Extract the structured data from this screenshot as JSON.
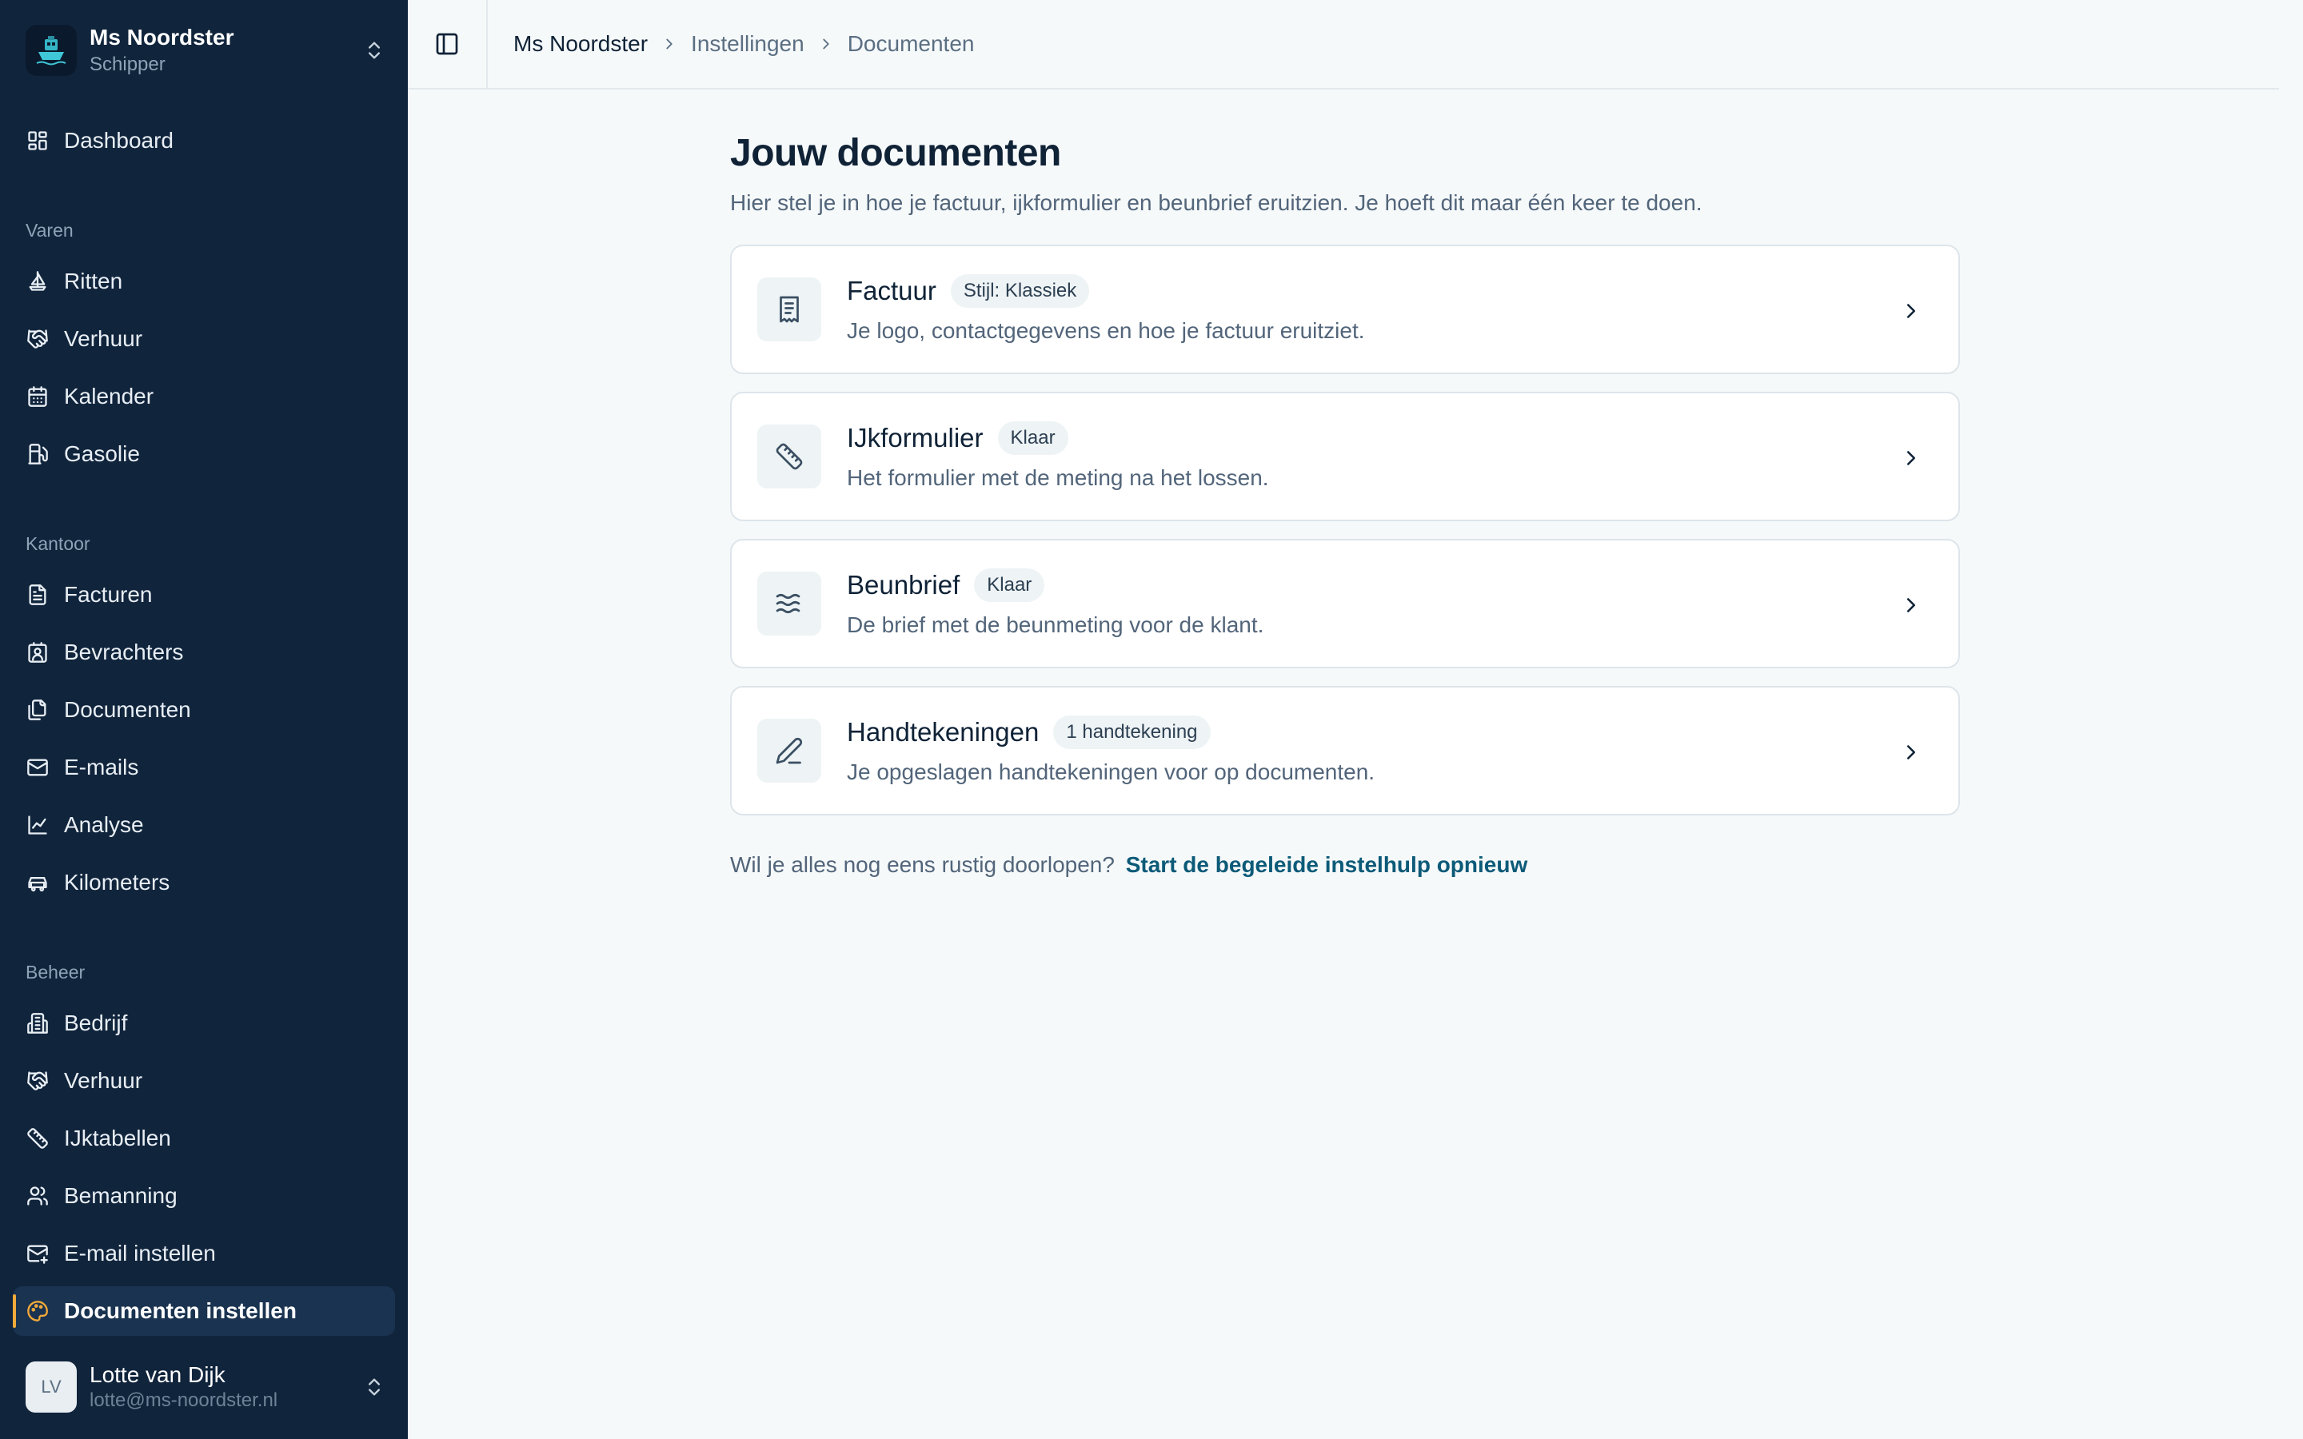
{
  "sidebar": {
    "org": {
      "name": "Ms Noordster",
      "role": "Schipper",
      "logo_icon": "ship-logo-icon"
    },
    "dashboard": {
      "label": "Dashboard",
      "icon": "dashboard-icon"
    },
    "groups": [
      {
        "label": "Varen",
        "items": [
          {
            "label": "Ritten",
            "icon": "sailboat-icon"
          },
          {
            "label": "Verhuur",
            "icon": "handshake-icon"
          },
          {
            "label": "Kalender",
            "icon": "calendar-icon"
          },
          {
            "label": "Gasolie",
            "icon": "fuel-icon"
          }
        ]
      },
      {
        "label": "Kantoor",
        "items": [
          {
            "label": "Facturen",
            "icon": "file-text-icon"
          },
          {
            "label": "Bevrachters",
            "icon": "contact-icon"
          },
          {
            "label": "Documenten",
            "icon": "files-icon"
          },
          {
            "label": "E-mails",
            "icon": "mail-icon"
          },
          {
            "label": "Analyse",
            "icon": "chart-line-icon"
          },
          {
            "label": "Kilometers",
            "icon": "car-icon"
          }
        ]
      },
      {
        "label": "Beheer",
        "items": [
          {
            "label": "Bedrijf",
            "icon": "building-icon"
          },
          {
            "label": "Verhuur",
            "icon": "handshake-icon"
          },
          {
            "label": "IJktabellen",
            "icon": "ruler-icon"
          },
          {
            "label": "Bemanning",
            "icon": "users-icon"
          },
          {
            "label": "E-mail instellen",
            "icon": "mail-settings-icon"
          },
          {
            "label": "Documenten instellen",
            "icon": "palette-icon",
            "active": true
          }
        ]
      }
    ],
    "user": {
      "initials": "LV",
      "name": "Lotte van Dijk",
      "email": "lotte@ms-noordster.nl"
    }
  },
  "topbar": {
    "breadcrumb": [
      "Ms Noordster",
      "Instellingen",
      "Documenten"
    ]
  },
  "main": {
    "title": "Jouw documenten",
    "subtitle": "Hier stel je in hoe je factuur, ijkformulier en beunbrief eruitzien. Je hoeft dit maar één keer te doen.",
    "cards": [
      {
        "title": "Factuur",
        "badge": "Stijl: Klassiek",
        "description": "Je logo, contactgegevens en hoe je factuur eruitziet.",
        "icon": "receipt-icon"
      },
      {
        "title": "IJkformulier",
        "badge": "Klaar",
        "description": "Het formulier met de meting na het lossen.",
        "icon": "ruler-icon"
      },
      {
        "title": "Beunbrief",
        "badge": "Klaar",
        "description": "De brief met de beunmeting voor de klant.",
        "icon": "waves-icon"
      },
      {
        "title": "Handtekeningen",
        "badge": "1 handtekening",
        "description": "Je opgeslagen handtekeningen voor op documenten.",
        "icon": "pen-icon"
      }
    ],
    "footer_text": "Wil je alles nog eens rustig doorlopen?",
    "footer_link": "Start de begeleide instelhulp opnieuw"
  },
  "colors": {
    "sidebar_bg": "#10243c",
    "accent": "#f0a93b",
    "link": "#0c5a78",
    "page_bg": "#f6f9fa"
  }
}
